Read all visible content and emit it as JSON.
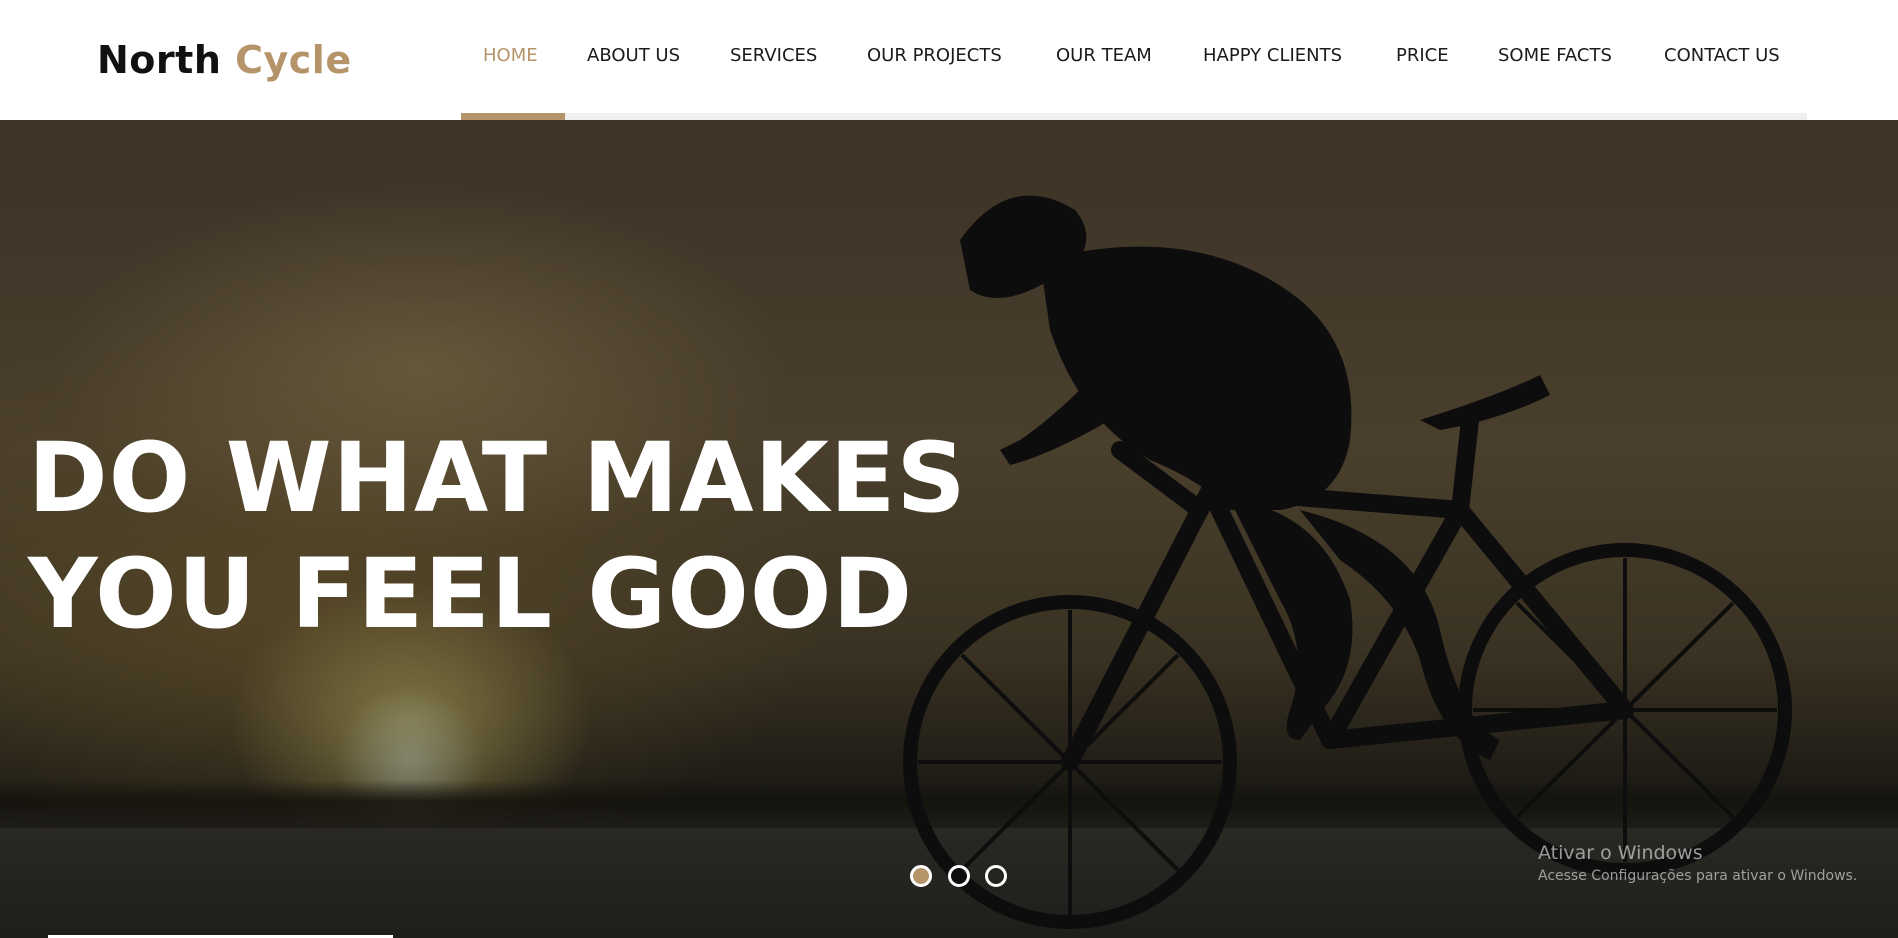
{
  "brand": {
    "name_first": "North",
    "name_second": "Cycle",
    "accent_color": "#b5946a"
  },
  "nav": {
    "items": [
      {
        "label": "HOME",
        "active": true
      },
      {
        "label": "ABOUT US"
      },
      {
        "label": "SERVICES"
      },
      {
        "label": "OUR PROJECTS"
      },
      {
        "label": "OUR TEAM"
      },
      {
        "label": "HAPPY CLIENTS"
      },
      {
        "label": "PRICE"
      },
      {
        "label": "SOME FACTS"
      },
      {
        "label": "CONTACT US"
      }
    ]
  },
  "hero": {
    "headline_line1": "DO WHAT MAKES",
    "headline_line2": "YOU FEEL GOOD",
    "slides_total": 3,
    "active_slide": 1
  },
  "os_watermark": {
    "title": "Ativar o Windows",
    "subtitle": "Acesse Configurações para ativar o Windows."
  }
}
